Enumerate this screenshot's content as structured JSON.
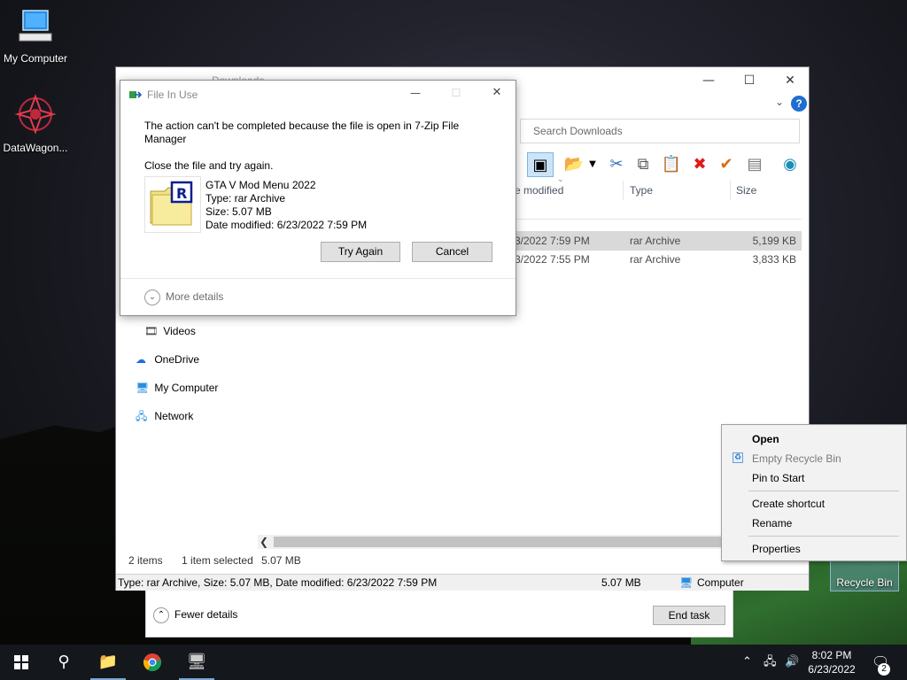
{
  "desktop": {
    "icons": [
      {
        "label": "My Computer",
        "icon": "computer-icon"
      },
      {
        "label": "DataWagon...",
        "icon": "datawagon-icon"
      },
      {
        "label": "Recycle Bin",
        "icon": "recycle-bin-icon"
      }
    ]
  },
  "explorer": {
    "title": "Downloads",
    "search_placeholder": "Search Downloads",
    "columns": [
      "e modified",
      "Type",
      "Size"
    ],
    "files": [
      {
        "date": "3/2022 7:59 PM",
        "type": "rar Archive",
        "size": "5,199 KB",
        "selected": true
      },
      {
        "date": "3/2022 7:55 PM",
        "type": "rar Archive",
        "size": "3,833 KB",
        "selected": false
      }
    ],
    "nav": [
      {
        "label": "Videos",
        "icon": "videos-icon"
      },
      {
        "label": "OneDrive",
        "icon": "onedrive-icon"
      },
      {
        "label": "My Computer",
        "icon": "computer-icon"
      },
      {
        "label": "Network",
        "icon": "network-icon"
      }
    ],
    "status": {
      "items": "2 items",
      "selected": "1 item selected",
      "selected_size": "5.07 MB"
    },
    "infobar": {
      "details": "Type: rar Archive, Size: 5.07 MB, Date modified: 6/23/2022 7:59 PM",
      "size": "5.07 MB",
      "location": "Computer"
    }
  },
  "taskmgr": {
    "fewer_details": "Fewer details",
    "end_task": "End task"
  },
  "dialog": {
    "title": "File In Use",
    "message": "The action can't be completed because the file is open in 7-Zip File Manager",
    "instruction": "Close the file and try again.",
    "file": {
      "name": "GTA V Mod Menu 2022",
      "type": "Type: rar Archive",
      "size": "Size: 5.07 MB",
      "modified": "Date modified: 6/23/2022 7:59 PM"
    },
    "try_again": "Try Again",
    "cancel": "Cancel",
    "more_details": "More details"
  },
  "context_menu": {
    "items": [
      {
        "label": "Open",
        "bold": true,
        "disabled": false
      },
      {
        "label": "Empty Recycle Bin",
        "bold": false,
        "disabled": true
      },
      {
        "label": "Pin to Start",
        "bold": false,
        "disabled": false
      },
      {
        "label": "Create shortcut",
        "bold": false,
        "disabled": false
      },
      {
        "label": "Rename",
        "bold": false,
        "disabled": false
      },
      {
        "label": "Properties",
        "bold": false,
        "disabled": false
      }
    ]
  },
  "taskbar": {
    "time": "8:02 PM",
    "date": "6/23/2022",
    "notifications": "2"
  }
}
